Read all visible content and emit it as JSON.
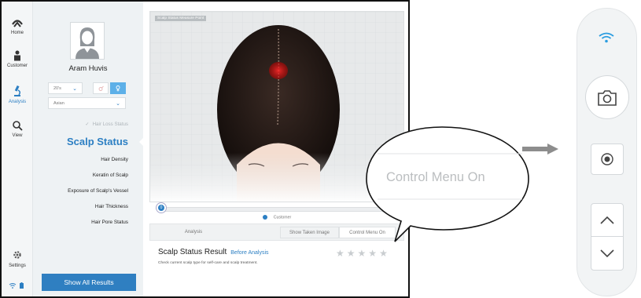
{
  "nav": {
    "items": [
      {
        "label": "Home",
        "icon": "home-icon"
      },
      {
        "label": "Customer",
        "icon": "customer-icon"
      },
      {
        "label": "Analysis",
        "icon": "microscope-icon",
        "active": true
      },
      {
        "label": "View",
        "icon": "view-icon"
      }
    ],
    "settings_label": "Settings"
  },
  "profile": {
    "name": "Aram Huvis",
    "age_value": "20's",
    "ethnicity_value": "Asian"
  },
  "menu": {
    "completed_item": "Hair Loss Status",
    "active_item": "Scalp Status",
    "sub_items": [
      "Hair Density",
      "Keratin of Scalp",
      "Exposure of Scalp's Vessel",
      "Hair Thickness",
      "Hair Pore Status"
    ]
  },
  "show_all_label": "Show All Results",
  "main": {
    "photo_tag": "Scalp Status Measure Point",
    "legend_label": "Customer",
    "slider_value_label": "0",
    "slider_value": 0,
    "tabs": {
      "analysis": "Analysis",
      "show_taken": "Show Taken Image",
      "control_menu": "Control Menu On"
    },
    "result_title": "Scalp Status Result",
    "before_analysis": "Before Analysis",
    "result_desc": "Check current scalp type for self-care and scalp treatment.",
    "star_rating": 0,
    "star_max": 5
  },
  "callout": {
    "text": "Control Menu On"
  },
  "control_bar": {
    "buttons": [
      "wifi-icon",
      "camera-icon",
      "record-icon",
      "chevron-up-icon",
      "chevron-down-icon"
    ]
  },
  "colors": {
    "accent": "#2c7fc3",
    "panel_bg": "#eef2f4",
    "frame": "#111111"
  }
}
